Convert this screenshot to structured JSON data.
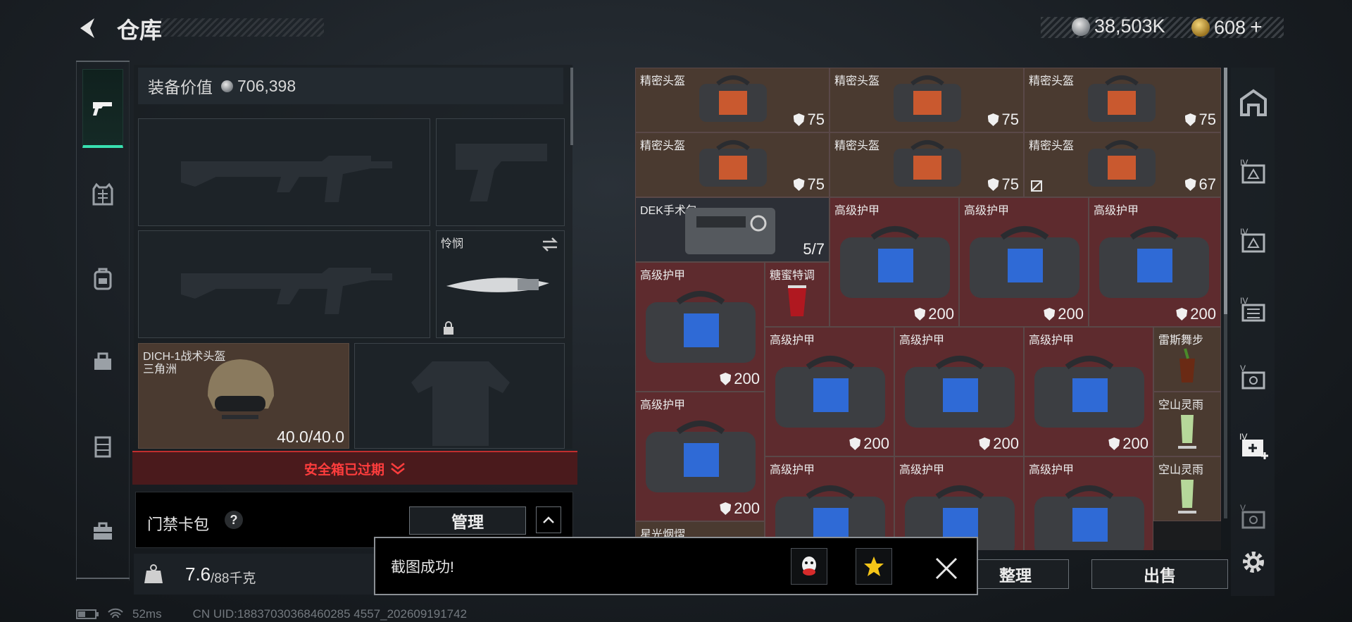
{
  "header": {
    "title": "仓库"
  },
  "currency": [
    {
      "icon": "silver-coin-icon",
      "value": "38,503K"
    },
    {
      "icon": "gold-coin-icon",
      "value": "608"
    }
  ],
  "currency_add": "+",
  "left_nav": [
    "pistol-icon",
    "vest-icon",
    "backpack-icon",
    "bag-icon",
    "locker-icon",
    "briefcase-icon"
  ],
  "equipment": {
    "value_label": "装备价值",
    "value": "706,398",
    "melee_name": "怜悯",
    "helmet_name": "DICH-1战术头盔",
    "helmet_sub": "三角洲",
    "helmet_durability": "40.0/40.0"
  },
  "safe_box": {
    "label": "安全箱已过期"
  },
  "card_pack": {
    "label": "门禁卡包",
    "help": "?",
    "manage": "管理"
  },
  "weight": {
    "icon_text": "KG",
    "current": "7.6",
    "capacity": "/88千克"
  },
  "inventory": {
    "helmets": [
      {
        "name": "精密头盔",
        "durability": "75"
      },
      {
        "name": "精密头盔",
        "durability": "75"
      },
      {
        "name": "精密头盔",
        "durability": "75"
      },
      {
        "name": "精密头盔",
        "durability": "75"
      },
      {
        "name": "精密头盔",
        "durability": "75"
      },
      {
        "name": "精密头盔",
        "durability": "67"
      }
    ],
    "medkit": {
      "name": "DEK手术包",
      "count": "5/7"
    },
    "armors": [
      {
        "name": "高级护甲",
        "durability": "200"
      },
      {
        "name": "高级护甲",
        "durability": "200"
      },
      {
        "name": "高级护甲",
        "durability": "200"
      },
      {
        "name": "高级护甲",
        "durability": "200"
      },
      {
        "name": "高级护甲",
        "durability": "200"
      },
      {
        "name": "高级护甲",
        "durability": "200"
      },
      {
        "name": "高级护甲",
        "durability": "200"
      },
      {
        "name": "高级护甲",
        "durability": "200"
      },
      {
        "name": "高级护甲",
        "durability": ""
      },
      {
        "name": "高级护甲",
        "durability": ""
      },
      {
        "name": "高级护甲",
        "durability": ""
      }
    ],
    "drinks": [
      {
        "name": "糖蜜特调"
      },
      {
        "name": "雷斯舞步"
      },
      {
        "name": "空山灵雨"
      },
      {
        "name": "空山灵雨"
      },
      {
        "name": "星光烟熠"
      }
    ]
  },
  "right_nav": [
    "home-icon",
    "tier4-box-icon",
    "tier4-box-icon",
    "tier4-stack-icon",
    "tier5-box-icon",
    "add-box-icon",
    "tier5-box-icon"
  ],
  "buttons": {
    "sort": "整理",
    "sell": "出售"
  },
  "toast": {
    "message": "截图成功!"
  },
  "status": {
    "ping": "52ms",
    "uid": "CN UID:18837030368460285 4557_202609191742"
  }
}
